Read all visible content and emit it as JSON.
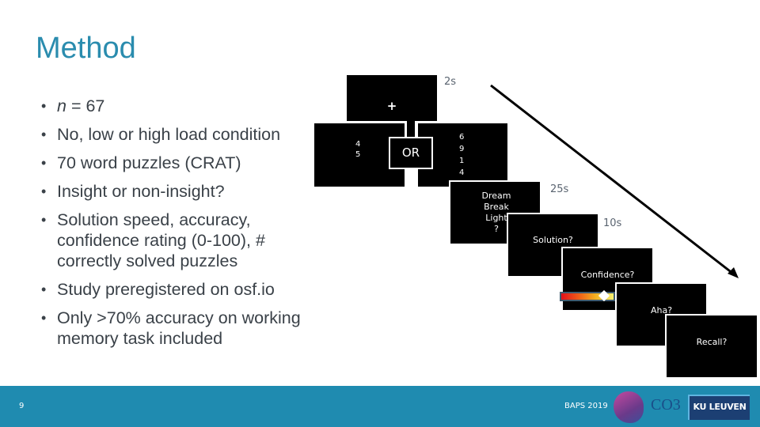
{
  "slide": {
    "title": "Method",
    "bullets": [
      {
        "prefix": "n",
        "text": " = 67"
      },
      {
        "text": "No, low or high load condition"
      },
      {
        "text": "70 word puzzles (CRAT)"
      },
      {
        "text": "Insight or non-insight?"
      },
      {
        "text": "Solution speed, accuracy, confidence rating (0-100), # correctly solved puzzles"
      },
      {
        "text": "Study preregistered on osf.io"
      },
      {
        "text": "Only >70% accuracy on working memory task included"
      }
    ]
  },
  "diagram": {
    "fixation": {
      "symbol": "+",
      "duration": "2s"
    },
    "load_low": {
      "digits": [
        "4",
        "5"
      ]
    },
    "or_label": "OR",
    "load_high": {
      "digits": [
        "6",
        "9",
        "1",
        "4"
      ]
    },
    "puzzle": {
      "words": [
        "Dream",
        "Break",
        "Light",
        "?"
      ],
      "duration": "25s"
    },
    "solution": {
      "prompt": "Solution?",
      "duration": "10s"
    },
    "confidence": {
      "prompt": "Confidence?",
      "slider_value_fraction": 0.8
    },
    "aha": {
      "prompt": "Aha?"
    },
    "recall": {
      "prompt": "Recall?"
    },
    "arrow_meaning": "time-arrow"
  },
  "footer": {
    "page_number": "9",
    "conference": "BAPS 2019",
    "logo_co3": "CO3",
    "logo_kul": "KU LEUVEN",
    "bar_color": "#1f8bb0"
  }
}
